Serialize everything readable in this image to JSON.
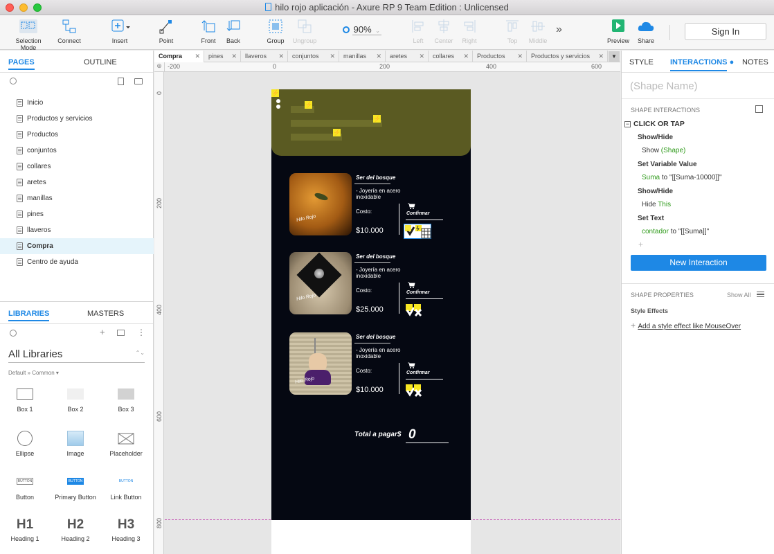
{
  "window": {
    "title": "hilo rojo aplicación - Axure RP 9 Team Edition : Unlicensed"
  },
  "toolbar": {
    "selection_mode": "Selection Mode",
    "connect": "Connect",
    "insert": "Insert",
    "point": "Point",
    "front": "Front",
    "back": "Back",
    "group": "Group",
    "ungroup": "Ungroup",
    "zoom": "90%",
    "left": "Left",
    "center": "Center",
    "right": "Right",
    "top": "Top",
    "middle": "Middle",
    "more": "»",
    "preview": "Preview",
    "share": "Share",
    "sign_in": "Sign In"
  },
  "left_panel": {
    "tabs": [
      "PAGES",
      "OUTLINE"
    ],
    "pages": [
      "Inicio",
      "Productos y servicios",
      "Productos",
      "conjuntos",
      "collares",
      "aretes",
      "manillas",
      "pines",
      "llaveros",
      "Compra",
      "Centro de ayuda"
    ],
    "selected_page": "Compra",
    "lib_tabs": [
      "LIBRARIES",
      "MASTERS"
    ],
    "library_name": "All Libraries",
    "library_sub": "Default » Common ▾",
    "widgets": [
      "Box 1",
      "Box 2",
      "Box 3",
      "Ellipse",
      "Image",
      "Placeholder",
      "Button",
      "Primary Button",
      "Link Button",
      "Heading 1",
      "Heading 2",
      "Heading 3"
    ],
    "button_texts": [
      "BUTTON",
      "BUTTON",
      "BUTTON"
    ],
    "heading_glyphs": [
      "H1",
      "H2",
      "H3"
    ]
  },
  "canvas": {
    "tabs": [
      "Compra",
      "pines",
      "llaveros",
      "conjuntos",
      "manillas",
      "aretes",
      "collares",
      "Productos",
      "Productos y servicios"
    ],
    "hruler": [
      "-200",
      "0",
      "200",
      "400",
      "600"
    ],
    "vruler": [
      "0",
      "200",
      "400",
      "600",
      "800"
    ]
  },
  "phone": {
    "products": [
      {
        "name": "Ser del bosque",
        "desc": "- Joyería en acero inoxidable",
        "cost_label": "Costo:",
        "price": "$10.000",
        "confirm": "Confirmar"
      },
      {
        "name": "Ser del bosque",
        "desc": "- Joyería en acero inoxidable",
        "cost_label": "Costo:",
        "price": "$25.000",
        "confirm": "Confirmar"
      },
      {
        "name": "Ser del bosque",
        "desc": "- Joyería en acero inoxidable",
        "cost_label": "Costo:",
        "price": "$10.000",
        "confirm": "Confirmar"
      }
    ],
    "brand_mark": "Hilo Rojo",
    "total_label": "Total a pagar$",
    "total_value": "0"
  },
  "right_panel": {
    "tabs": [
      "STYLE",
      "INTERACTIONS",
      "NOTES"
    ],
    "shape_name_placeholder": "(Shape Name)",
    "shape_interactions": "SHAPE INTERACTIONS",
    "event": "CLICK OR TAP",
    "actions": [
      {
        "title": "Show/Hide",
        "pre": "Show ",
        "hl": "(Shape)",
        "post": ""
      },
      {
        "title": "Set Variable Value",
        "pre": "",
        "hl": "Suma",
        "post": " to \"[[Suma-10000]]\""
      },
      {
        "title": "Show/Hide",
        "pre": "Hide ",
        "hl": "This",
        "post": ""
      },
      {
        "title": "Set Text",
        "pre": "",
        "hl": "contador",
        "post": " to \"[[Suma]]\""
      }
    ],
    "plus": "+",
    "new_interaction": "New Interaction",
    "shape_properties": "SHAPE PROPERTIES",
    "show_all": "Show All",
    "style_effects": "Style Effects",
    "add_style_effect": "Add a style effect like MouseOver"
  }
}
